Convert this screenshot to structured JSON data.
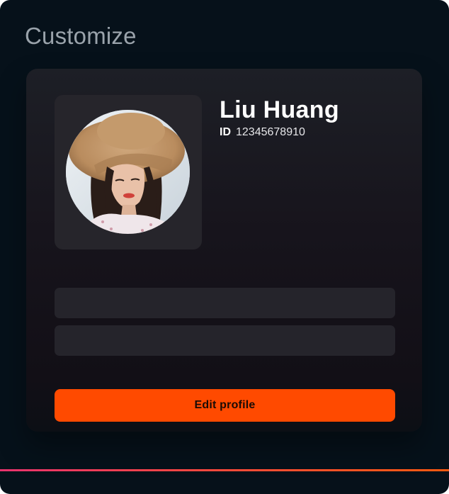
{
  "header": {
    "title": "Customize"
  },
  "profile": {
    "name": "Liu Huang",
    "id_label": "ID",
    "id_value": "12345678910",
    "avatar_alt": "Liu Huang avatar"
  },
  "actions": {
    "edit_label": "Edit profile"
  },
  "colors": {
    "background": "#06111a",
    "card": "#1a1820",
    "field": "#25242b",
    "accent": "#ff4a00",
    "accent_line_start": "#e8336e",
    "accent_line_end": "#ff5a10"
  }
}
